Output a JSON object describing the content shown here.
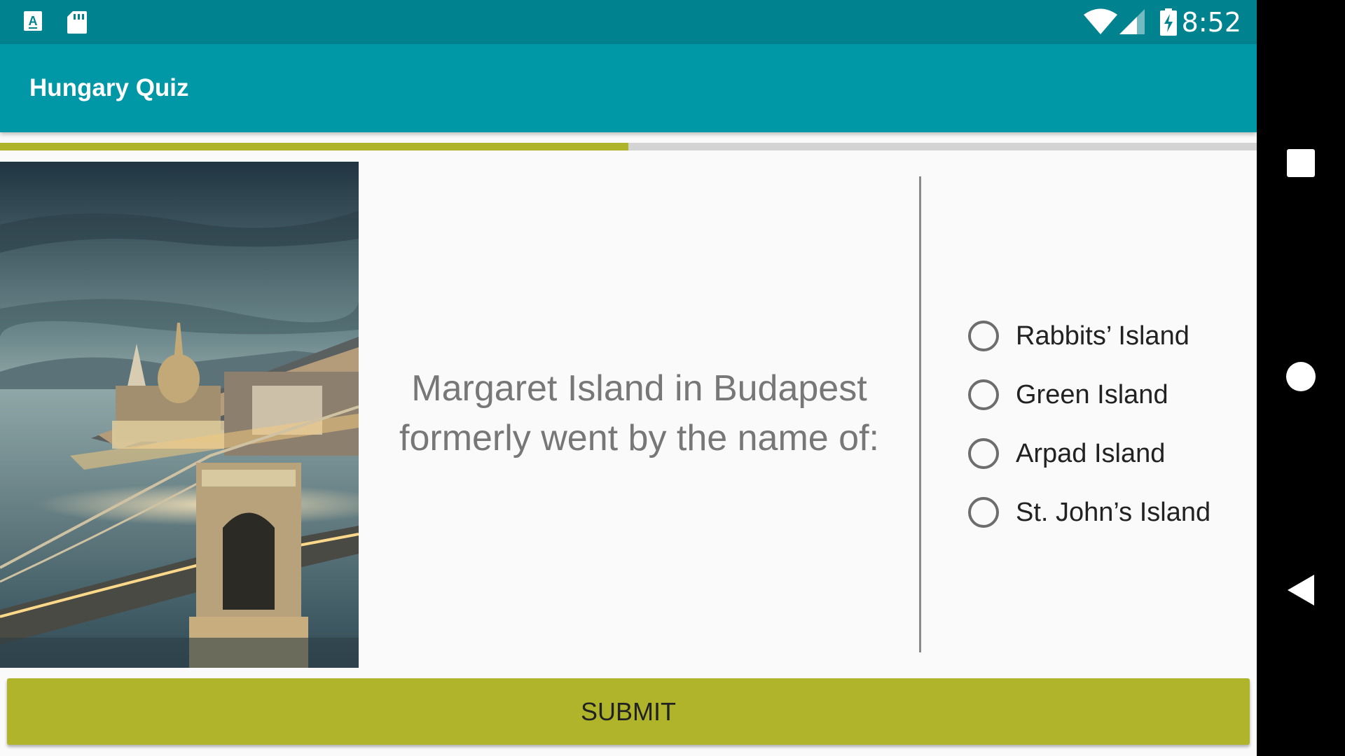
{
  "status_bar": {
    "time": "8:52",
    "left_icons": [
      "keyboard-a-icon",
      "sd-card-icon"
    ],
    "right_icons": [
      "wifi-icon",
      "cell-signal-icon",
      "battery-charging-icon"
    ]
  },
  "toolbar": {
    "title": "Hungary Quiz"
  },
  "progress": {
    "fraction": 0.5
  },
  "image": {
    "subject": "Budapest Chain Bridge and Parliament at dusk"
  },
  "question": {
    "text": "Margaret Island in Budapest formerly went by the name of:"
  },
  "options": [
    {
      "label": "Rabbits’ Island",
      "selected": false
    },
    {
      "label": "Green Island",
      "selected": false
    },
    {
      "label": "Arpad Island",
      "selected": false
    },
    {
      "label": "St. John’s Island",
      "selected": false
    }
  ],
  "submit": {
    "label": "SUBMIT"
  },
  "nav_bar": {
    "buttons": [
      "recents-square-icon",
      "home-circle-icon",
      "back-triangle-icon"
    ]
  },
  "colors": {
    "status_bar": "#00838f",
    "toolbar": "#0097a7",
    "accent": "#afb42b",
    "track": "#d4d4d4",
    "background": "#fafafa"
  }
}
